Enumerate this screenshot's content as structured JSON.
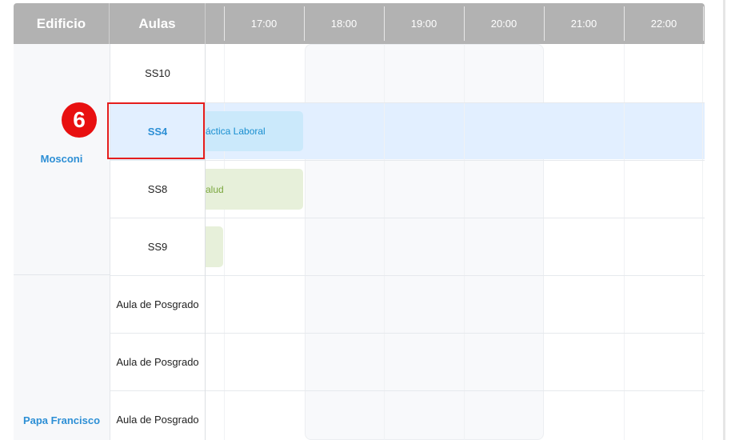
{
  "header": {
    "building_col": "Edificio",
    "rooms_col": "Aulas",
    "times": [
      "17:00",
      "18:00",
      "19:00",
      "20:00",
      "21:00",
      "22:00"
    ]
  },
  "buildings": [
    {
      "name": "Mosconi"
    },
    {
      "name": "Papa Francisco"
    }
  ],
  "rooms": [
    "SS10",
    "SS4",
    "SS8",
    "SS9",
    "Aula de Posgrado",
    "Aula de Posgrado",
    "Aula de Posgrado"
  ],
  "selected_room_index": 1,
  "events": [
    {
      "label": "áctica Laboral",
      "color": "blue"
    },
    {
      "label": "alud",
      "color": "green"
    },
    {
      "label": "",
      "color": "green"
    }
  ],
  "annotation": {
    "number": "6"
  },
  "colors": {
    "header_bg": "#b2b2b2",
    "accent": "#2d8fd5",
    "selected_bg": "#e2efff",
    "marker_red": "#e81010"
  }
}
